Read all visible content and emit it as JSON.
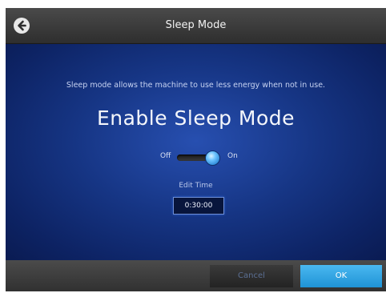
{
  "header": {
    "title": "Sleep Mode",
    "back_icon": "arrow-left-circle-icon"
  },
  "main": {
    "description": "Sleep mode allows the machine to use less energy when not in use.",
    "heading": "Enable Sleep Mode",
    "toggle": {
      "off_label": "Off",
      "on_label": "On",
      "state": "on"
    },
    "edit_time": {
      "label": "Edit Time",
      "value": "0:30:00"
    }
  },
  "footer": {
    "cancel_label": "Cancel",
    "ok_label": "OK"
  },
  "colors": {
    "accent": "#2a9de0",
    "header_bg": "#3a3a3a",
    "content_bg": "#163584"
  }
}
